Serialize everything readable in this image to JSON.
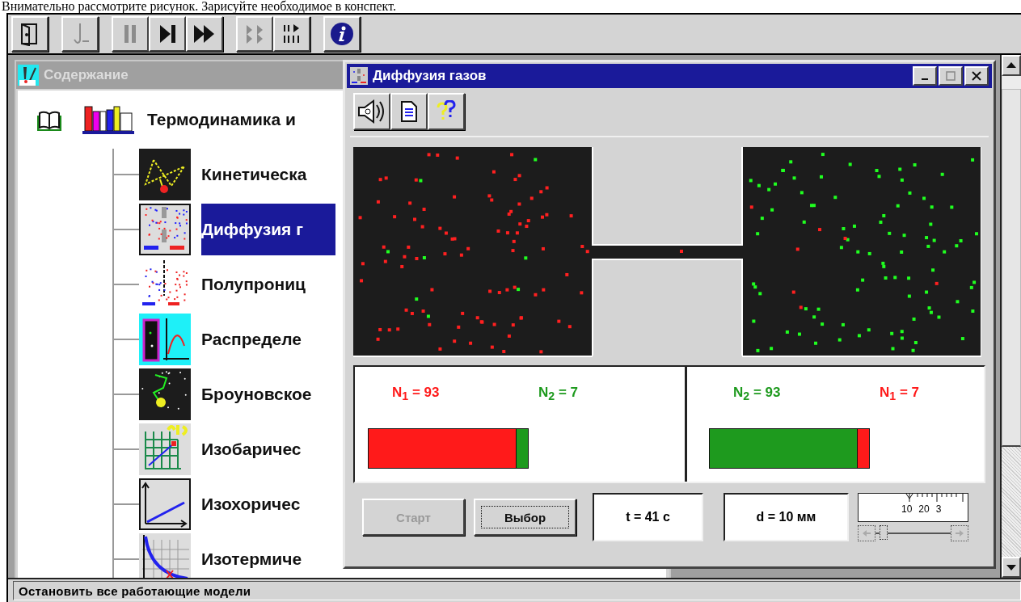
{
  "page_instruction": "Внимательно рассмотрите рисунок. Зарисуйте необходимое в конспект.",
  "toolbar": {
    "groups": [
      [
        {
          "disabled": false
        }
      ],
      [
        {
          "disabled": true
        }
      ],
      [
        {
          "disabled": true
        },
        {
          "disabled": false
        },
        {
          "disabled": false
        }
      ],
      [
        {
          "disabled": true
        },
        {
          "disabled": false
        }
      ],
      [
        {
          "disabled": false
        }
      ]
    ]
  },
  "contents_window": {
    "title": "Содержание",
    "active": false,
    "tree": [
      {
        "label": "Термодинамика и",
        "expanded": true,
        "selected": false,
        "children": [
          {
            "label": "Кинетическа",
            "selected": false
          },
          {
            "label": "Диффузия г",
            "selected": true
          },
          {
            "label": "Полупрониц",
            "selected": false
          },
          {
            "label": "Распределе",
            "selected": false
          },
          {
            "label": "Броуновское",
            "selected": false
          },
          {
            "label": "Изобаричес",
            "selected": false
          },
          {
            "label": "Изохоричес",
            "selected": false
          },
          {
            "label": "Изотермиче",
            "selected": false
          }
        ]
      }
    ]
  },
  "diffusion_window": {
    "title": "Диффузия газов",
    "active": true,
    "counts": [
      {
        "labels": [
          {
            "text": "N$_{1}$ = 93",
            "color": "#ff1a1a"
          },
          {
            "text": "N$_{2}$ = 7",
            "color": "#1e9a1e"
          }
        ],
        "bar": [
          {
            "level": 0.93,
            "color": "#ff1a1a"
          },
          {
            "level": 0.07,
            "color": "#1e9a1e"
          }
        ]
      },
      {
        "labels": [
          {
            "text": "N$_{2}$ = 93",
            "color": "#1e9a1e"
          },
          {
            "text": "N$_{1}$ = 7",
            "color": "#ff1a1a"
          }
        ],
        "bar": [
          {
            "level": 0.93,
            "color": "#1e9a1e"
          },
          {
            "level": 0.07,
            "color": "#ff1a1a"
          }
        ]
      }
    ],
    "buttons": [
      {
        "label": "Старт",
        "disabled": true,
        "focused": false
      },
      {
        "label": "Выбор",
        "disabled": false,
        "focused": true
      }
    ],
    "readouts": [
      "t = 41 с",
      "d = 10 мм"
    ],
    "scale": {
      "labels": [
        "10",
        "20",
        "3"
      ],
      "level": 0.05
    }
  },
  "status_bar": "Остановить все работающие модели"
}
